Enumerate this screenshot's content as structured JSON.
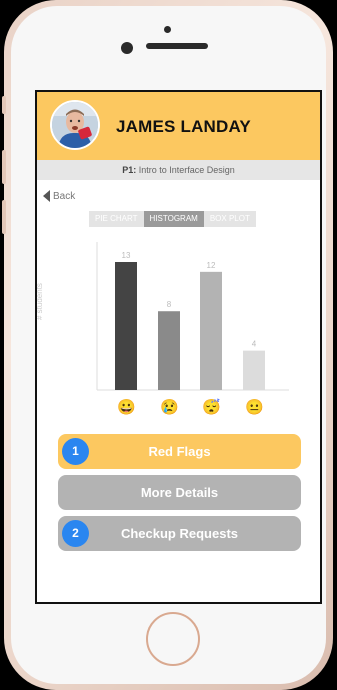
{
  "profile": {
    "name": "JAMES LANDAY"
  },
  "course": {
    "code": "P1:",
    "title": " Intro to Interface Design"
  },
  "nav": {
    "back_label": "Back"
  },
  "tabs": [
    {
      "label": "PIE CHART",
      "active": false
    },
    {
      "label": "HISTOGRAM",
      "active": true
    },
    {
      "label": "BOX PLOT",
      "active": false
    }
  ],
  "chart_data": {
    "type": "bar",
    "categories": [
      "😀",
      "😢",
      "😴",
      "😐"
    ],
    "values": [
      13,
      8,
      12,
      4
    ],
    "bar_colors": [
      "#444444",
      "#8a8a8a",
      "#b3b3b3",
      "#dcdcdc"
    ],
    "ylabel": "# students",
    "title": "",
    "xlabel": "",
    "ylim": [
      0,
      14
    ]
  },
  "actions": [
    {
      "label": "Red Flags",
      "badge": "1",
      "color": "#fcc860"
    },
    {
      "label": "More Details",
      "badge": "",
      "color": "#b3b3b3"
    },
    {
      "label": "Checkup Requests",
      "badge": "2",
      "color": "#b3b3b3"
    }
  ],
  "colors": {
    "header": "#fcc860",
    "badge": "#2a86f0"
  }
}
